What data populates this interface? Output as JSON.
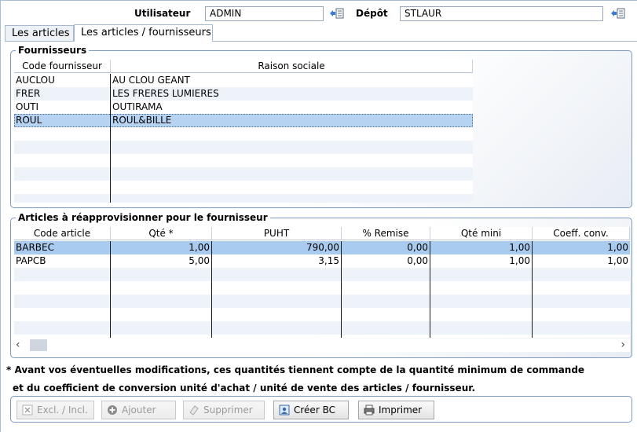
{
  "header": {
    "user_label": "Utilisateur",
    "user_value": "ADMIN",
    "depot_label": "Dépôt",
    "depot_value": "STLAUR"
  },
  "tabs": [
    {
      "label": "Les articles",
      "active": false
    },
    {
      "label": "Les articles / fournisseurs",
      "active": true
    }
  ],
  "suppliers": {
    "title": "Fournisseurs",
    "columns": [
      "Code fournisseur",
      "Raison sociale"
    ],
    "rows": [
      {
        "code": "AUCLOU",
        "name": "AU CLOU GEANT"
      },
      {
        "code": "FRER",
        "name": "LES FRERES LUMIERES"
      },
      {
        "code": "OUTI",
        "name": "OUTIRAMA"
      },
      {
        "code": "ROUL",
        "name": "ROUL&BILLE"
      }
    ],
    "selected_index": 3
  },
  "articles": {
    "title": "Articles à réapprovisionner pour le fournisseur",
    "columns": [
      "Code article",
      "Qté *",
      "PUHT",
      "% Remise",
      "Qté mini",
      "Coeff. conv."
    ],
    "rows": [
      {
        "code": "BARBEC",
        "qte": "1,00",
        "puht": "790,00",
        "remise": "0,00",
        "qte_mini": "1,00",
        "coeff": "1,00"
      },
      {
        "code": "PAPCB",
        "qte": "5,00",
        "puht": "3,15",
        "remise": "0,00",
        "qte_mini": "1,00",
        "coeff": "1,00"
      }
    ],
    "selected_index": 0
  },
  "notes": {
    "line1": "* Avant vos éventuelles modifications, ces quantités tiennent compte de la quantité minimum de commande",
    "line2": "et du coefficient de conversion unité d'achat / unité de vente des articles / fournisseur."
  },
  "buttons": {
    "excl_incl": "Excl. / Incl.",
    "ajouter": "Ajouter",
    "supprimer": "Supprimer",
    "creer_bc": "Créer BC",
    "imprimer": "Imprimer"
  },
  "colors": {
    "selected_row": "#a9cbef",
    "alt_row": "#eef3fa",
    "group_border": "#7e9bbf"
  }
}
